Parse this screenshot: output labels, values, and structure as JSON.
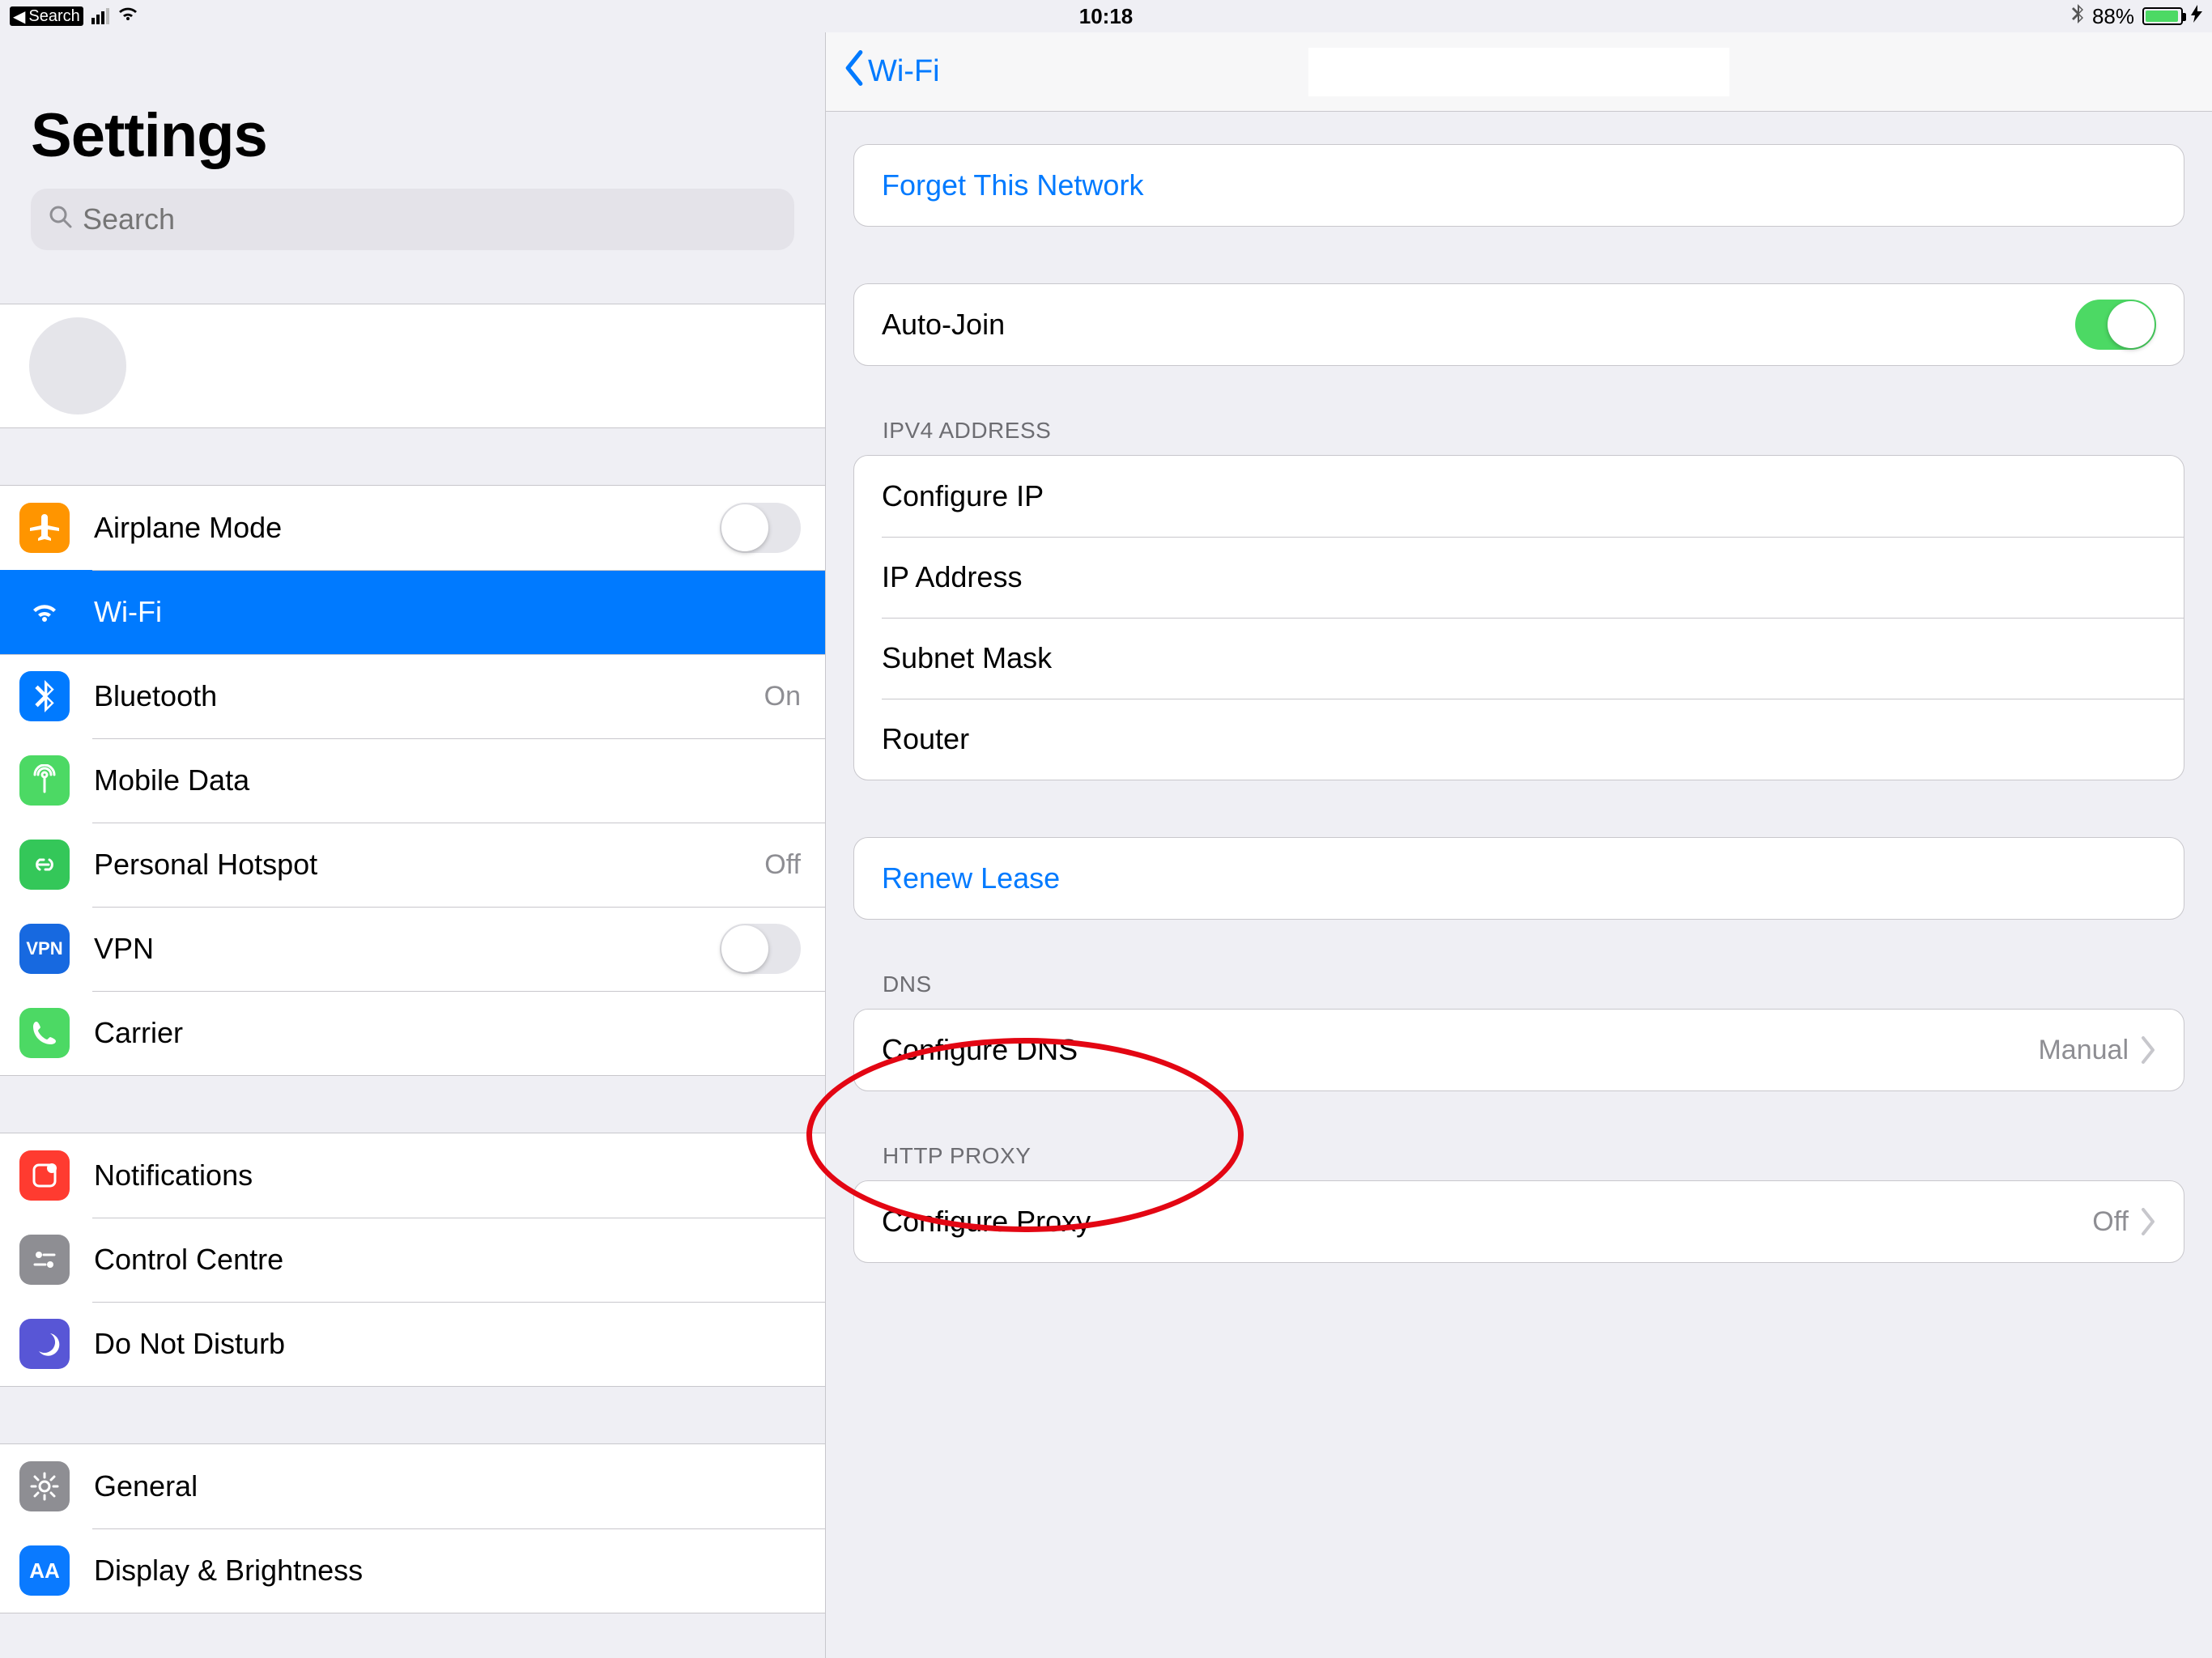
{
  "status": {
    "back_search": "Search",
    "time": "10:18",
    "battery_pct": "88%"
  },
  "sidebar": {
    "title": "Settings",
    "search_placeholder": "Search",
    "items": {
      "airplane": "Airplane Mode",
      "wifi": "Wi-Fi",
      "bluetooth": "Bluetooth",
      "bluetooth_value": "On",
      "mobile_data": "Mobile Data",
      "hotspot": "Personal Hotspot",
      "hotspot_value": "Off",
      "vpn": "VPN",
      "vpn_badge": "VPN",
      "carrier": "Carrier",
      "notifications": "Notifications",
      "control_centre": "Control Centre",
      "dnd": "Do Not Disturb",
      "general": "General",
      "display": "Display & Brightness",
      "aa_badge": "AA"
    }
  },
  "detail": {
    "back_label": "Wi-Fi",
    "forget": "Forget This Network",
    "autojoin": "Auto-Join",
    "ipv4_header": "IPV4 Address",
    "configure_ip": "Configure IP",
    "ip_address": "IP Address",
    "subnet": "Subnet Mask",
    "router": "Router",
    "renew": "Renew Lease",
    "dns_header": "DNS",
    "configure_dns": "Configure DNS",
    "configure_dns_value": "Manual",
    "proxy_header": "HTTP Proxy",
    "configure_proxy": "Configure Proxy",
    "configure_proxy_value": "Off"
  }
}
